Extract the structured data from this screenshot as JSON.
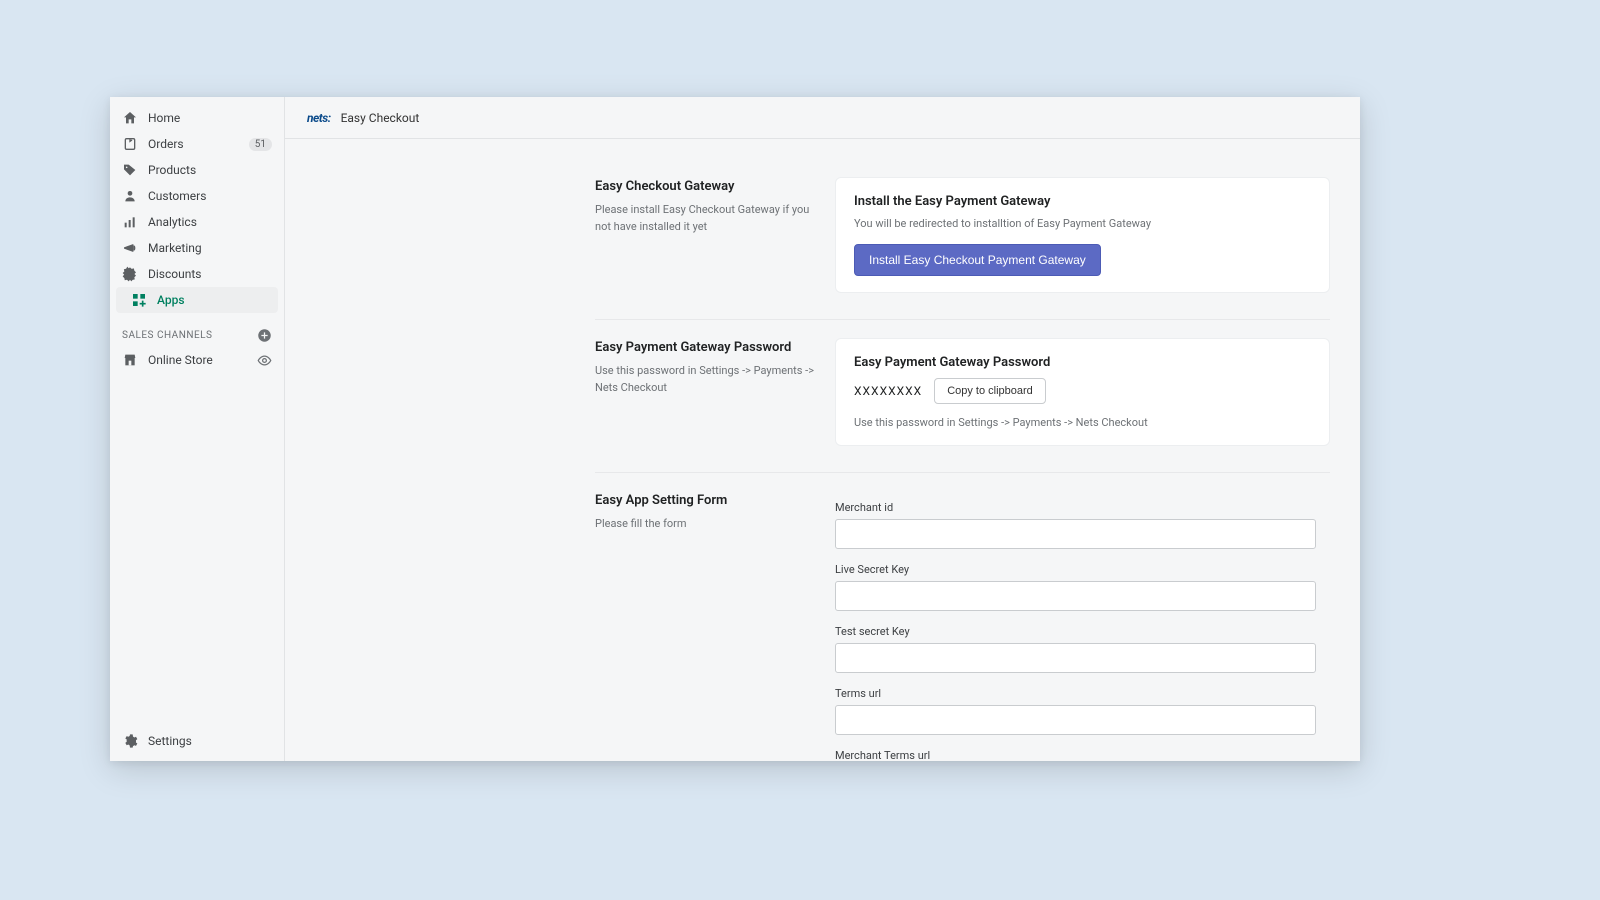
{
  "sidebar": {
    "items": [
      {
        "label": "Home"
      },
      {
        "label": "Orders",
        "badge": "51"
      },
      {
        "label": "Products"
      },
      {
        "label": "Customers"
      },
      {
        "label": "Analytics"
      },
      {
        "label": "Marketing"
      },
      {
        "label": "Discounts"
      },
      {
        "label": "Apps"
      }
    ],
    "channels_label": "SALES CHANNELS",
    "channels": [
      {
        "label": "Online Store"
      }
    ],
    "settings_label": "Settings"
  },
  "topbar": {
    "brand": "nets:",
    "title": "Easy Checkout"
  },
  "sections": {
    "gateway": {
      "heading": "Easy Checkout Gateway",
      "desc": "Please install Easy Checkout Gateway if you not have installed it yet",
      "card_title": "Install the Easy Payment Gateway",
      "card_desc": "You will be redirected to installtion of Easy Payment Gateway",
      "button": "Install Easy Checkout Payment Gateway"
    },
    "password": {
      "heading": "Easy Payment Gateway Password",
      "desc": "Use this password in Settings -> Payments -> Nets Checkout",
      "card_title": "Easy Payment Gateway Password",
      "value": "XXXXXXXX",
      "copy_button": "Copy to clipboard",
      "card_hint": "Use this password in Settings -> Payments -> Nets Checkout"
    },
    "form": {
      "heading": "Easy App Setting Form",
      "desc": "Please fill the form",
      "fields": [
        {
          "label": "Merchant id"
        },
        {
          "label": "Live Secret Key"
        },
        {
          "label": "Test secret Key"
        },
        {
          "label": "Terms url"
        },
        {
          "label": "Merchant Terms url"
        }
      ]
    }
  }
}
